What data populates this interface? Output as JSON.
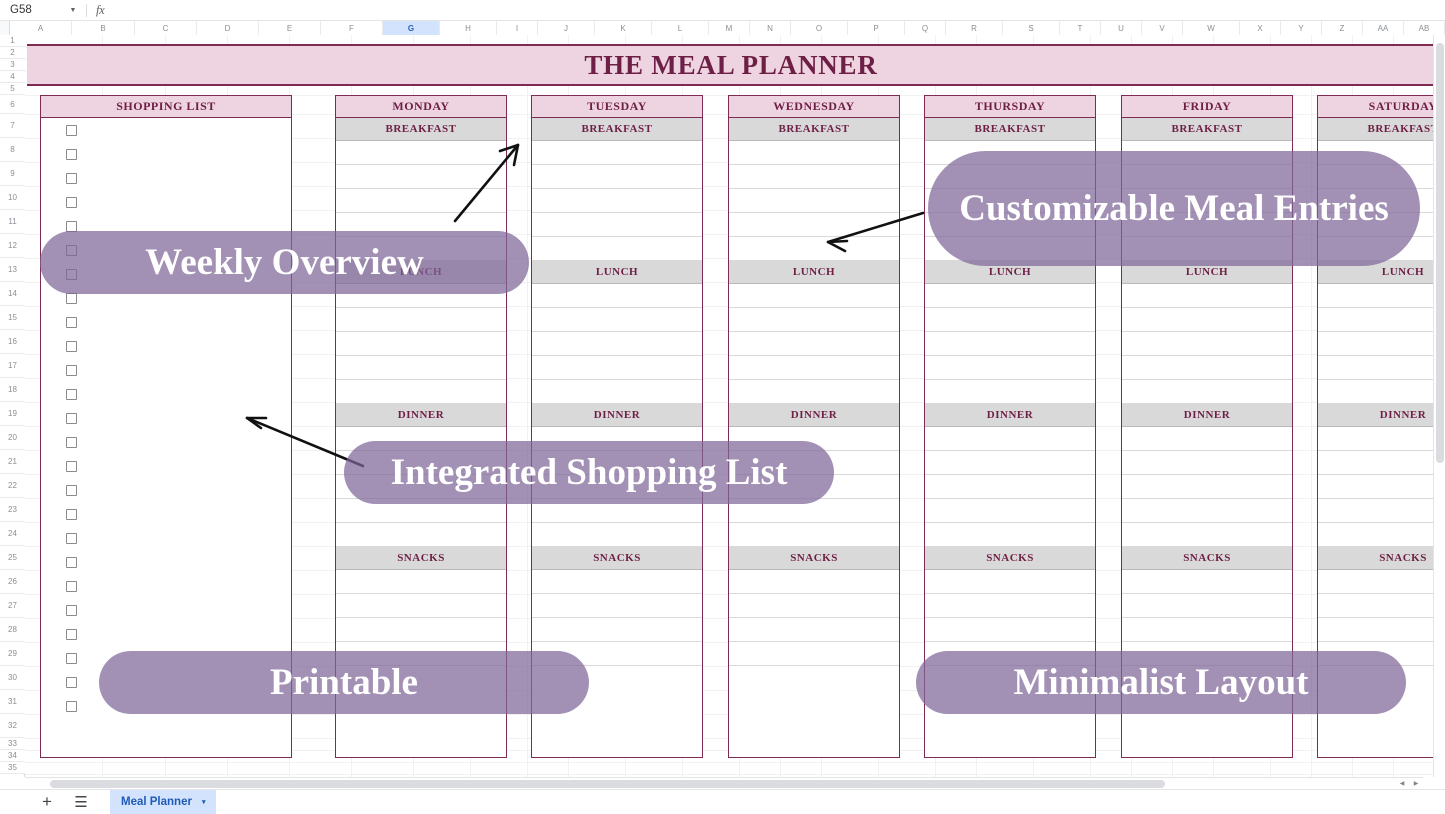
{
  "app": {
    "name_box_value": "G58",
    "name_box_caret": "chevron-down-icon",
    "fx_label": "fx",
    "formula_value": "",
    "formula_placeholder": ""
  },
  "grid": {
    "column_headers": [
      "A",
      "B",
      "C",
      "D",
      "E",
      "F",
      "G",
      "H",
      "I",
      "J",
      "K",
      "L",
      "M",
      "N",
      "O",
      "P",
      "Q",
      "R",
      "S",
      "T",
      "U",
      "V",
      "W",
      "X",
      "Y",
      "Z",
      "AA",
      "AB"
    ],
    "selected_column": "G",
    "row_headers": [
      "1",
      "2",
      "3",
      "4",
      "5",
      "6",
      "7",
      "8",
      "9",
      "10",
      "11",
      "12",
      "13",
      "14",
      "15",
      "16",
      "17",
      "18",
      "19",
      "20",
      "21",
      "22",
      "23",
      "24",
      "25",
      "26",
      "27",
      "28",
      "29",
      "30",
      "31",
      "32",
      "33",
      "34",
      "35"
    ]
  },
  "sheet": {
    "title": "THE MEAL PLANNER",
    "shopping_list_header": "SHOPPING LIST",
    "shopping_checkbox_count": 25,
    "days": [
      "MONDAY",
      "TUESDAY",
      "WEDNESDAY",
      "THURSDAY",
      "FRIDAY",
      "SATURDAY"
    ],
    "meals": [
      "BREAKFAST",
      "LUNCH",
      "DINNER",
      "SNACKS"
    ],
    "lines_per_meal": 5,
    "entry_values": []
  },
  "annotations": [
    {
      "id": "weekly-overview",
      "label": "Weekly Overview"
    },
    {
      "id": "customizable-meal-entries",
      "label": "Customizable Meal Entries"
    },
    {
      "id": "integrated-shopping-list",
      "label": "Integrated Shopping List"
    },
    {
      "id": "printable",
      "label": "Printable"
    },
    {
      "id": "minimalist-layout",
      "label": "Minimalist Layout"
    }
  ],
  "sheet_tabs": {
    "add_label": "+",
    "all_sheets_label": "☰",
    "tabs": [
      {
        "label": "Meal Planner",
        "active": true,
        "caret": "▾"
      }
    ]
  },
  "colors": {
    "banner_bg": "#eed3e1",
    "banner_border": "#7d2b52",
    "heading_text": "#6e1f45",
    "meal_head_bg": "#d9d9d9",
    "badge_bg": "#7e6799",
    "tab_active_bg": "#d3e3fd",
    "tab_active_text": "#1f5bb5"
  }
}
